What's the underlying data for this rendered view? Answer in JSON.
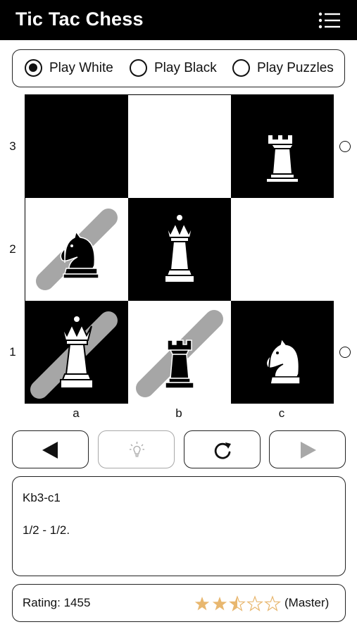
{
  "app": {
    "title": "Tic Tac Chess"
  },
  "modes": [
    {
      "label": "Play White",
      "selected": true
    },
    {
      "label": "Play Black",
      "selected": false
    },
    {
      "label": "Play Puzzles",
      "selected": false
    }
  ],
  "board": {
    "ranks": [
      "3",
      "2",
      "1"
    ],
    "files": [
      "a",
      "b",
      "c"
    ],
    "squares": [
      {
        "square": "a3",
        "color": "dark",
        "piece": null,
        "highlight": false
      },
      {
        "square": "b3",
        "color": "light",
        "piece": null,
        "highlight": false
      },
      {
        "square": "c3",
        "color": "dark",
        "piece": "white-rook",
        "highlight": false
      },
      {
        "square": "a2",
        "color": "light",
        "piece": "black-knight",
        "highlight": true
      },
      {
        "square": "b2",
        "color": "dark",
        "piece": "white-queen",
        "highlight": false
      },
      {
        "square": "c2",
        "color": "light",
        "piece": null,
        "highlight": false
      },
      {
        "square": "a1",
        "color": "dark",
        "piece": "white-queen",
        "highlight": true
      },
      {
        "square": "b1",
        "color": "light",
        "piece": "black-rook",
        "highlight": true
      },
      {
        "square": "c1",
        "color": "dark",
        "piece": "white-knight",
        "highlight": false
      }
    ],
    "side_indicators": [
      {
        "rank": "3",
        "filled": false
      },
      {
        "rank": "1",
        "filled": false
      }
    ]
  },
  "controls": [
    {
      "icon": "back-icon",
      "enabled": true
    },
    {
      "icon": "hint-bulb-icon",
      "enabled": false
    },
    {
      "icon": "restart-icon",
      "enabled": true
    },
    {
      "icon": "forward-icon",
      "enabled": false
    }
  ],
  "log": {
    "move": "Kb3-c1",
    "result": "1/2 - 1/2."
  },
  "rating": {
    "label": "Rating: 1455",
    "stars": 2.5,
    "max_stars": 5,
    "level": "(Master)",
    "star_color": "#e8b76f"
  },
  "colors": {
    "header_bg": "#000000",
    "dark_square": "#000000",
    "light_square": "#ffffff",
    "highlight": "#a6a6a6",
    "disabled": "#a8a8a8"
  }
}
